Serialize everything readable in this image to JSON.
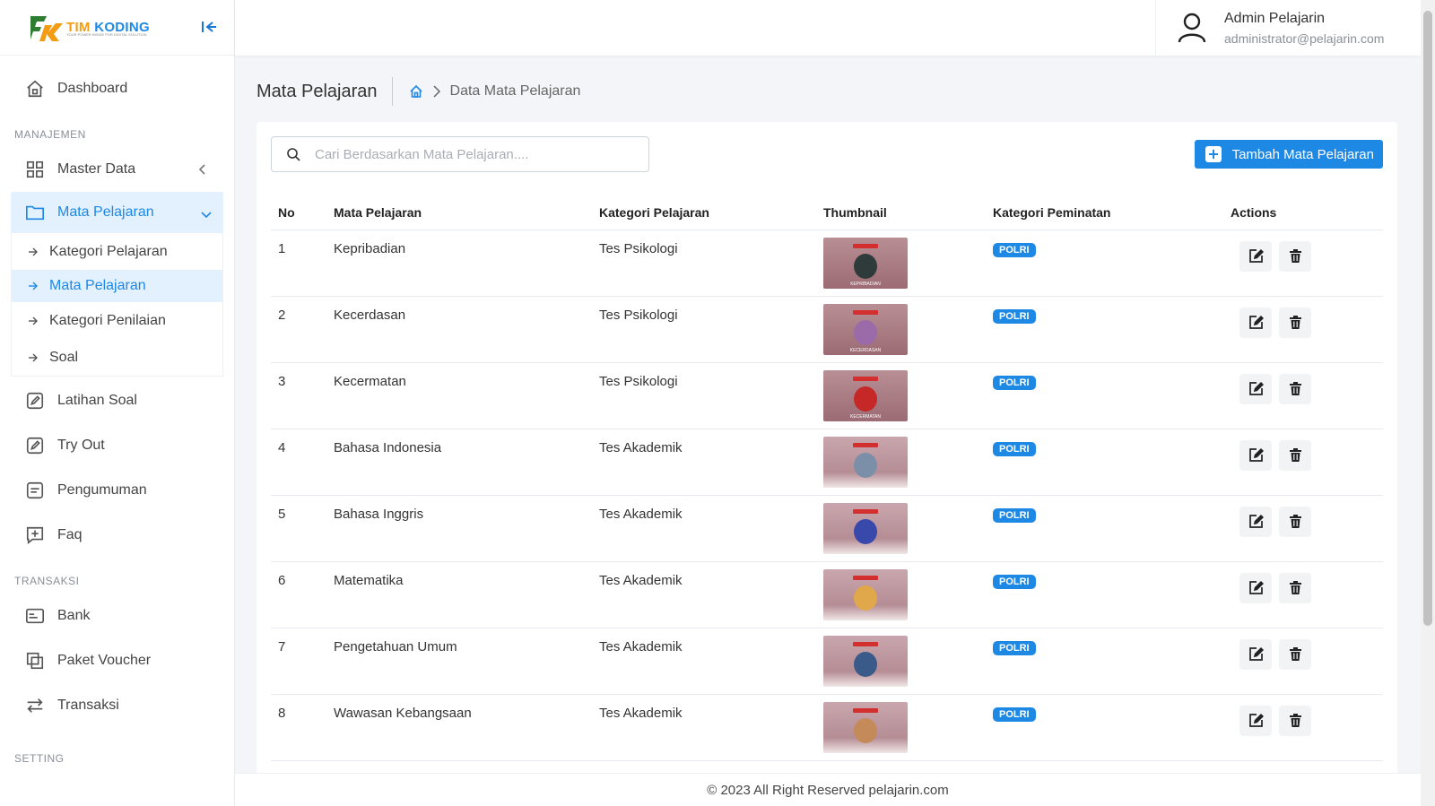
{
  "brand": {
    "name_part1": "TIM",
    "name_part2": "KODING",
    "tagline": "YOUR POWER INSIDE FOR DIGITAL SOLUTION"
  },
  "user": {
    "name": "Admin Pelajarin",
    "email": "administrator@pelajarin.com"
  },
  "sidebar": {
    "dashboard": "Dashboard",
    "section_manajemen": "MANAJEMEN",
    "master_data": "Master Data",
    "mata_pelajaran": "Mata Pelajaran",
    "sub_items": [
      "Kategori Pelajaran",
      "Mata Pelajaran",
      "Kategori Penilaian",
      "Soal"
    ],
    "latihan_soal": "Latihan Soal",
    "try_out": "Try Out",
    "pengumuman": "Pengumuman",
    "faq": "Faq",
    "section_transaksi": "TRANSAKSI",
    "bank": "Bank",
    "paket_voucher": "Paket Voucher",
    "transaksi": "Transaksi",
    "section_setting": "SETTING"
  },
  "page": {
    "title": "Mata Pelajaran",
    "breadcrumb_current": "Data Mata Pelajaran"
  },
  "search": {
    "placeholder": "Cari Berdasarkan Mata Pelajaran...."
  },
  "add_button": "Tambah Mata Pelajaran",
  "table": {
    "headers": [
      "No",
      "Mata Pelajaran",
      "Kategori Pelajaran",
      "Thumbnail",
      "Kategori Peminatan",
      "Actions"
    ],
    "rows": [
      {
        "no": "1",
        "mapel": "Kepribadian",
        "kategori": "Tes Psikologi",
        "thumb_caption": "KEPRIBADIAN",
        "peminatan": "POLRI"
      },
      {
        "no": "2",
        "mapel": "Kecerdasan",
        "kategori": "Tes Psikologi",
        "thumb_caption": "KECERDASAN",
        "peminatan": "POLRI"
      },
      {
        "no": "3",
        "mapel": "Kecermatan",
        "kategori": "Tes Psikologi",
        "thumb_caption": "KECERMATAN",
        "peminatan": "POLRI"
      },
      {
        "no": "4",
        "mapel": "Bahasa Indonesia",
        "kategori": "Tes Akademik",
        "thumb_caption": "",
        "peminatan": "POLRI"
      },
      {
        "no": "5",
        "mapel": "Bahasa Inggris",
        "kategori": "Tes Akademik",
        "thumb_caption": "",
        "peminatan": "POLRI"
      },
      {
        "no": "6",
        "mapel": "Matematika",
        "kategori": "Tes Akademik",
        "thumb_caption": "",
        "peminatan": "POLRI"
      },
      {
        "no": "7",
        "mapel": "Pengetahuan Umum",
        "kategori": "Tes Akademik",
        "thumb_caption": "",
        "peminatan": "POLRI"
      },
      {
        "no": "8",
        "mapel": "Wawasan Kebangsaan",
        "kategori": "Tes Akademik",
        "thumb_caption": "",
        "peminatan": "POLRI"
      }
    ]
  },
  "footer": "© 2023 All Right Reserved pelajarin.com",
  "colors": {
    "accent": "#1e88e5",
    "active_bg": "#e3f0fd",
    "brand_orange": "#f39c12"
  },
  "icons": {
    "dashboard": "home-icon",
    "master_data": "grid-icon",
    "mata_pelajaran": "folder-icon",
    "latihan_soal": "edit-square-icon",
    "try_out": "edit-square-icon",
    "pengumuman": "document-icon",
    "faq": "plus-message-icon",
    "bank": "card-icon",
    "paket_voucher": "copy-icon",
    "transaksi": "swap-icon",
    "row_edit": "edit-icon",
    "row_delete": "trash-icon"
  }
}
